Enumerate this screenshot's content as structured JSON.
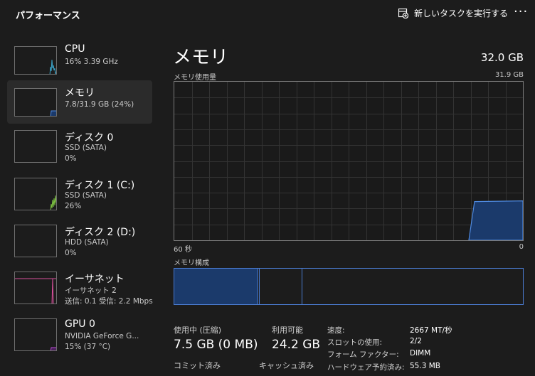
{
  "header": {
    "title": "パフォーマンス",
    "new_task_label": "新しいタスクを実行する",
    "more_label": "···"
  },
  "sidebar": {
    "items": [
      {
        "name": "CPU",
        "sub1": "16%  3.39 GHz",
        "sub2": ""
      },
      {
        "name": "メモリ",
        "sub1": "7.8/31.9 GB (24%)",
        "sub2": ""
      },
      {
        "name": "ディスク 0",
        "sub1": "SSD (SATA)",
        "sub2": "0%"
      },
      {
        "name": "ディスク 1 (C:)",
        "sub1": "SSD (SATA)",
        "sub2": "26%"
      },
      {
        "name": "ディスク 2 (D:)",
        "sub1": "HDD (SATA)",
        "sub2": "0%"
      },
      {
        "name": "イーサネット",
        "sub1": "イーサネット 2",
        "sub2": "送信: 0.1  受信: 2.2 Mbps"
      },
      {
        "name": "GPU 0",
        "sub1": "NVIDIA GeForce G...",
        "sub2": "15%  (37 °C)"
      }
    ]
  },
  "main": {
    "title": "メモリ",
    "total": "32.0 GB",
    "graph_label": "メモリ使用量",
    "graph_max": "31.9 GB",
    "time_left": "60 秒",
    "time_right": "0",
    "composition_label": "メモリ構成",
    "usage_fraction": 0.244
  },
  "stats": {
    "in_use_label": "使用中 (圧縮)",
    "in_use_value": "7.5 GB (0 MB)",
    "available_label": "利用可能",
    "available_value": "24.2 GB",
    "committed_label": "コミット済み",
    "cached_label": "キャッシュ済み"
  },
  "specs": {
    "speed_label": "速度:",
    "speed_value": "2667 MT/秒",
    "slots_label": "スロットの使用:",
    "slots_value": "2/2",
    "form_label": "フォーム ファクター:",
    "form_value": "DIMM",
    "hw_label": "ハードウェア予約済み:",
    "hw_value": "55.3 MB"
  },
  "colors": {
    "memory_accent": "#4f8ae0",
    "cpu_accent": "#3aa4c9",
    "disk_accent": "#7dc241",
    "ethernet_accent": "#d6509a",
    "gpu_accent": "#b54bd1"
  }
}
